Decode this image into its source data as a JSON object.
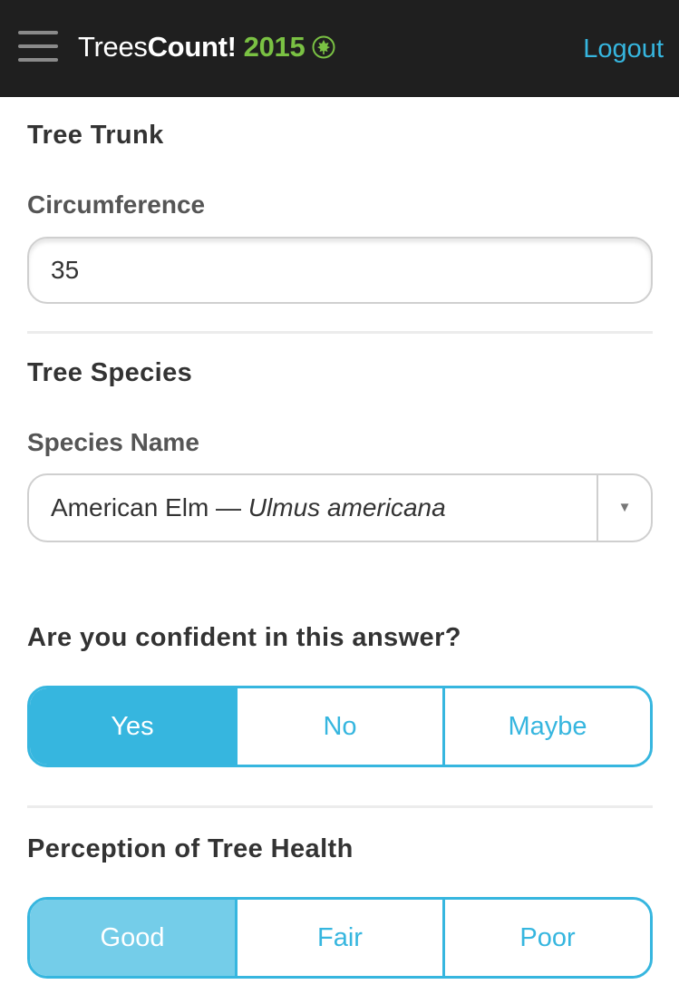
{
  "header": {
    "menu_icon": "hamburger-menu-icon",
    "logo_trees": "Trees",
    "logo_count": "Count!",
    "logo_year": "2015",
    "logo_icon": "leaf-icon",
    "logout_label": "Logout",
    "background": "#1f1f1f",
    "accent": "#36b6df",
    "brand_green": "#7ac143"
  },
  "tree_trunk": {
    "section_title": "Tree Trunk",
    "circumference_label": "Circumference",
    "circumference_value": "35"
  },
  "tree_species": {
    "section_title": "Tree Species",
    "species_label": "Species Name",
    "species_common": "American Elm",
    "species_dash": " — ",
    "species_latin": "Ulmus americana",
    "dropdown_icon": "chevron-down-icon"
  },
  "confidence": {
    "question": "Are you confident in this answer?",
    "options": [
      "Yes",
      "No",
      "Maybe"
    ],
    "selected": "Yes"
  },
  "health": {
    "section_title": "Perception of Tree Health",
    "options": [
      "Good",
      "Fair",
      "Poor"
    ],
    "selected": "Good"
  }
}
